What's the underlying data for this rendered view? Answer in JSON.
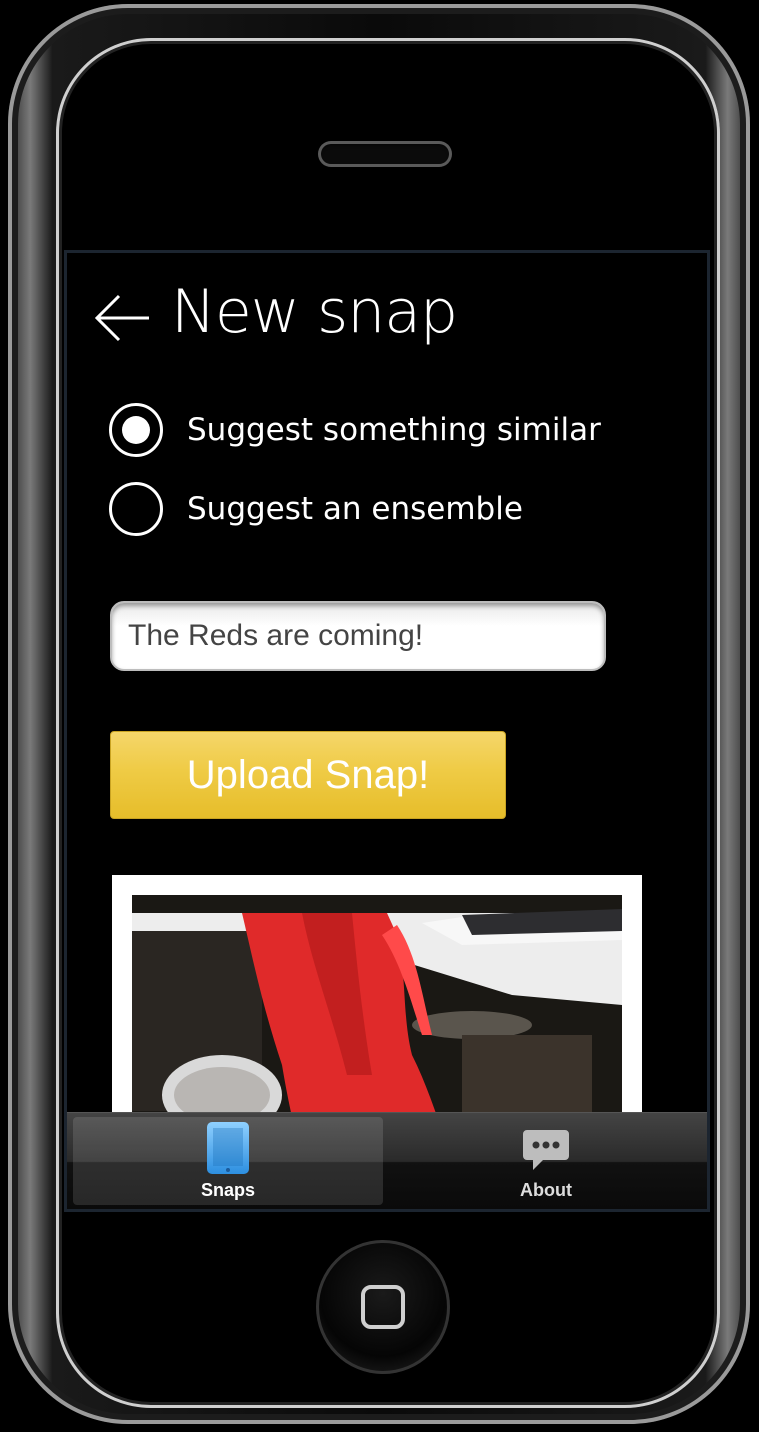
{
  "header": {
    "title": "New snap"
  },
  "options": [
    {
      "label": "Suggest something similar",
      "selected": true
    },
    {
      "label": "Suggest an ensemble",
      "selected": false
    }
  ],
  "caption_input": {
    "value": "The Reds are coming!"
  },
  "upload_button": {
    "label": "Upload Snap!"
  },
  "tabs": [
    {
      "label": "Snaps",
      "icon": "tablet-icon",
      "active": true
    },
    {
      "label": "About",
      "icon": "speech-bubble-icon",
      "active": false
    }
  ],
  "colors": {
    "accent": "#efcb45",
    "tab_icon_active": "#4aa8ec"
  }
}
